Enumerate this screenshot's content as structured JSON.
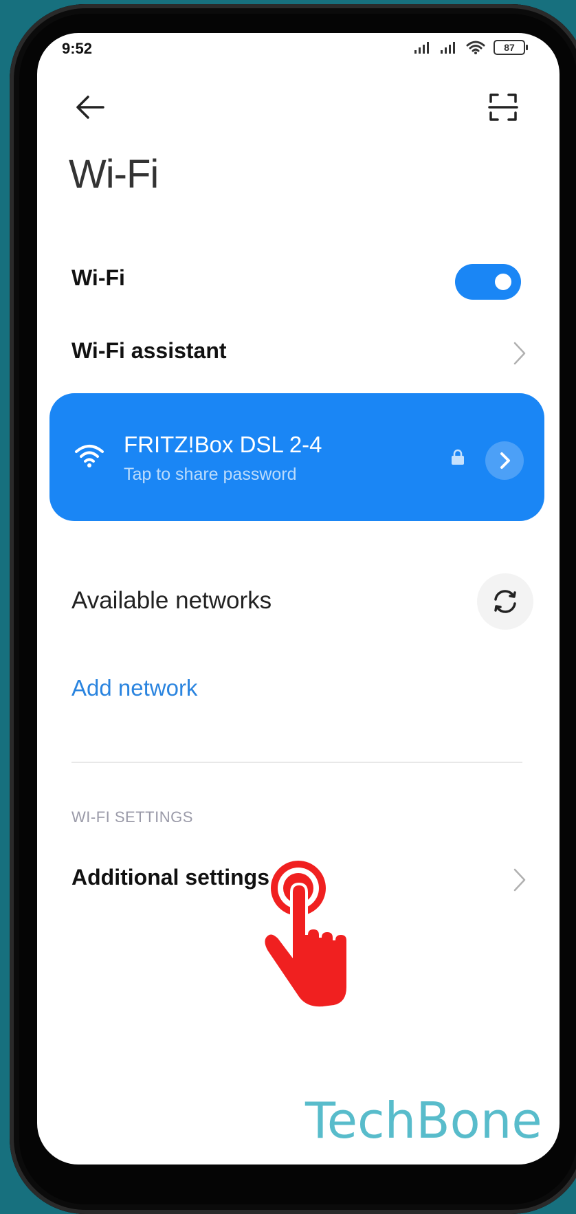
{
  "status_bar": {
    "time": "9:52",
    "battery": "87"
  },
  "header": {
    "title": "Wi-Fi"
  },
  "wifi_toggle": {
    "label": "Wi-Fi",
    "state": "on"
  },
  "wifi_assistant": {
    "label": "Wi-Fi assistant"
  },
  "connected_network": {
    "ssid": "FRITZ!Box DSL 2-4",
    "subtitle": "Tap to share password"
  },
  "available": {
    "title": "Available networks"
  },
  "add_network": {
    "label": "Add network"
  },
  "settings_section": {
    "header": "WI-FI SETTINGS",
    "additional_label": "Additional settings"
  },
  "watermark": "TechBone",
  "colors": {
    "accent": "#1a86f5",
    "link": "#2a84df",
    "background": "#17707e",
    "tap_indicator": "#f02020"
  },
  "icons": [
    "arrow-left-icon",
    "scan-icon",
    "chevron-right-icon",
    "wifi-icon",
    "lock-icon",
    "refresh-icon",
    "tap-hand-icon"
  ]
}
